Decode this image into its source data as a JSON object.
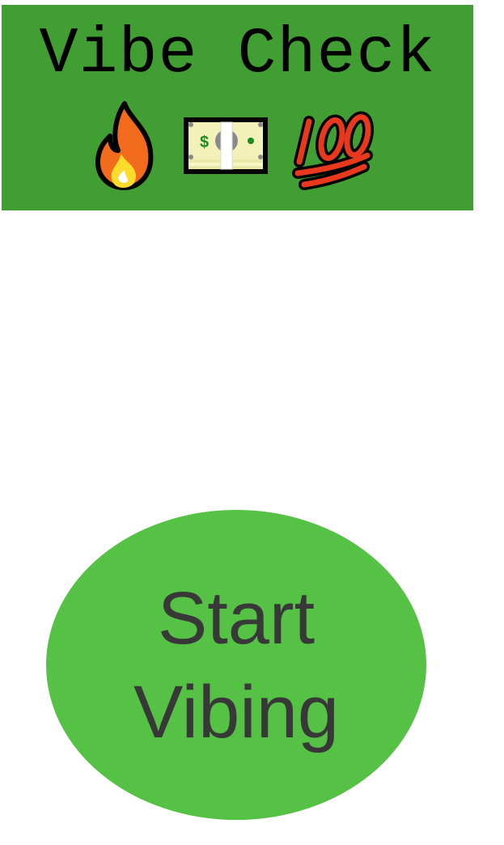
{
  "header": {
    "title": "Vibe Check",
    "background_color": "#409e32",
    "emojis": [
      "fire-icon",
      "dollar-bill-icon",
      "hundred-points-icon"
    ]
  },
  "main": {
    "start_button_label": "Start Vibing",
    "start_button_color": "#55c145",
    "start_button_text_color": "#383838"
  }
}
